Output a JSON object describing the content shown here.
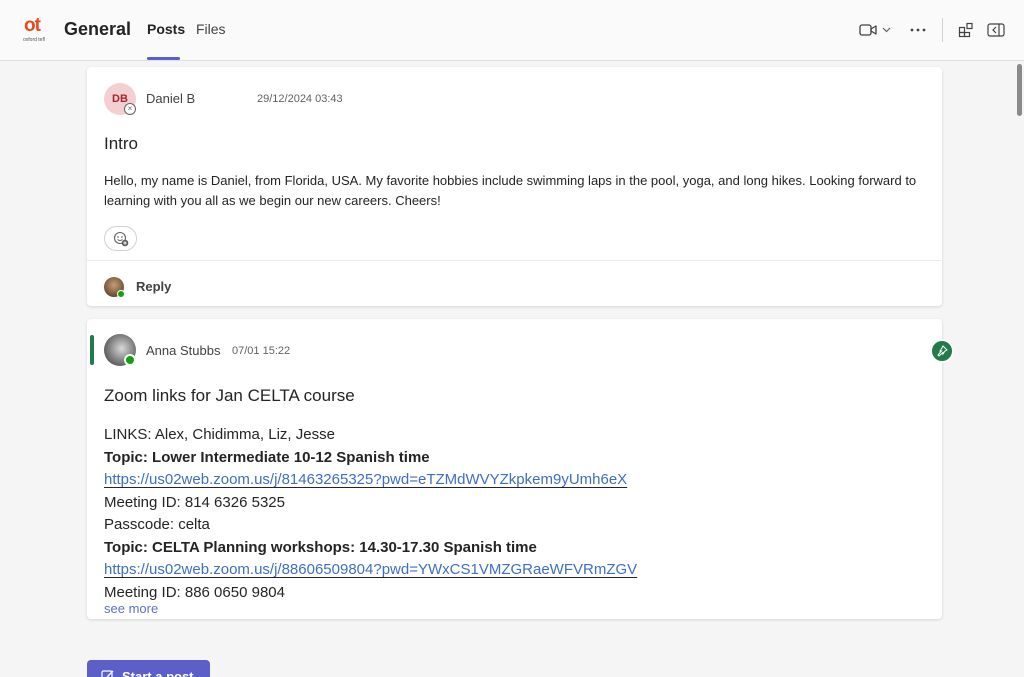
{
  "header": {
    "logo_text": "ot",
    "logo_subtext": "oxford tefl",
    "channel_title": "General",
    "tabs": [
      {
        "label": "Posts",
        "active": true
      },
      {
        "label": "Files",
        "active": false
      }
    ],
    "icons": [
      "video-icon",
      "chevron-down-icon",
      "more-icon",
      "apps-icon",
      "collapse-panel-icon"
    ],
    "accent_color": "#5b5fc7"
  },
  "posts": [
    {
      "avatar_initials": "DB",
      "author": "Daniel B",
      "timestamp": "29/12/2024 03:43",
      "title": "Intro",
      "body": "Hello, my name is Daniel, from Florida, USA. My favorite hobbies include swimming laps in the pool, yoga, and long hikes. Looking forward to learning with you all as we begin our new careers. Cheers!",
      "reply_label": "Reply"
    },
    {
      "author": "Anna Stubbs",
      "timestamp": "07/01 15:22",
      "title": "Zoom links for Jan CELTA course",
      "pinned": true,
      "lines": [
        {
          "text": "LINKS: Alex, Chidimma, Liz, Jesse",
          "style": "normal"
        },
        {
          "text": "Topic: Lower Intermediate 10-12 Spanish time",
          "style": "bold"
        },
        {
          "text": "https://us02web.zoom.us/j/81463265325?pwd=eTZMdWVYZkpkem9yUmh6eX",
          "style": "link"
        },
        {
          "text": "Meeting ID: 814 6326 5325",
          "style": "normal"
        },
        {
          "text": "Passcode: celta",
          "style": "normal"
        },
        {
          "text": "Topic: CELTA Planning workshops: 14.30-17.30 Spanish time",
          "style": "bold"
        },
        {
          "text": "https://us02web.zoom.us/j/88606509804?pwd=YWxCS1VMZGRaeWFVRmZGV",
          "style": "link"
        },
        {
          "text": "Meeting ID: 886 0650 9804",
          "style": "normal"
        }
      ],
      "see_more": "see more"
    }
  ],
  "start_post_label": "Start a post"
}
